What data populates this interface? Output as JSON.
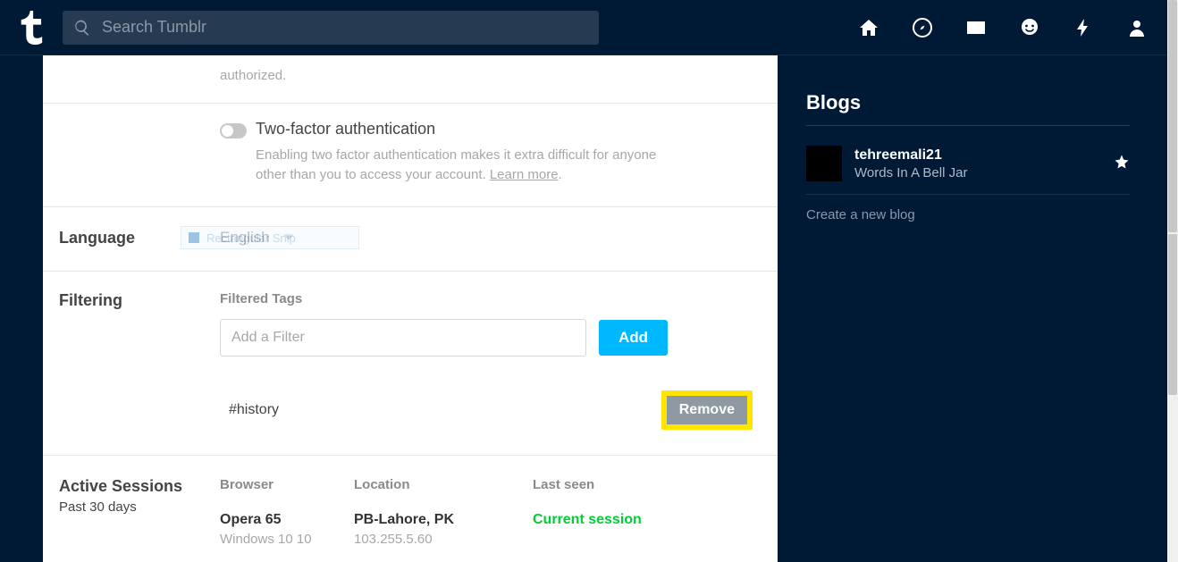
{
  "search": {
    "placeholder": "Search Tumblr"
  },
  "auth_fragment": "authorized.",
  "tfa": {
    "title": "Two-factor authentication",
    "desc_pre": "Enabling two factor authentication makes it extra difficult for anyone other than you to access your account. ",
    "learn_more": "Learn more"
  },
  "language": {
    "label": "Language",
    "value": "English",
    "ghost": "Rectangular Snip"
  },
  "filtering": {
    "label": "Filtering",
    "sub_label": "Filtered Tags",
    "input_placeholder": "Add a Filter",
    "add_label": "Add",
    "tag": "#history",
    "remove_label": "Remove"
  },
  "sessions": {
    "label": "Active Sessions",
    "sublabel": "Past 30 days",
    "head": {
      "browser": "Browser",
      "location": "Location",
      "last": "Last seen"
    },
    "row": {
      "browser": "Opera 65",
      "os": "Windows 10 10",
      "location": "PB-Lahore, PK",
      "ip": "103.255.5.60",
      "last": "Current session"
    }
  },
  "side": {
    "title": "Blogs",
    "blog": {
      "name": "tehreemali21",
      "sub": "Words In A Bell Jar"
    },
    "create": "Create a new blog"
  }
}
